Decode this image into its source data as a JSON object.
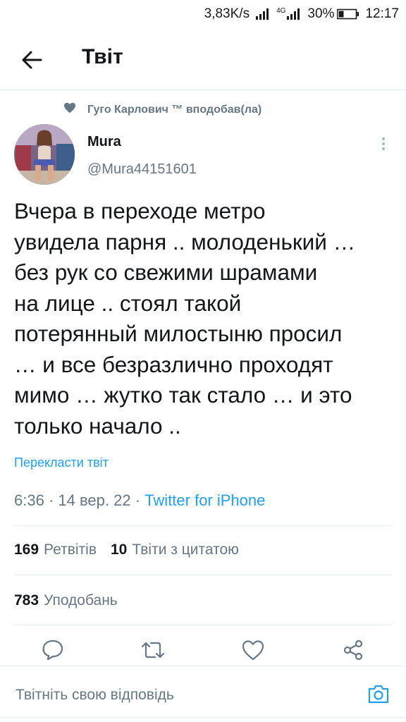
{
  "status_bar": {
    "speed": "3,83K/s",
    "network": "4G",
    "battery": "30%",
    "time": "12:17"
  },
  "header": {
    "back_icon": "arrow-left-icon",
    "title": "Твіт"
  },
  "social_context": {
    "icon": "heart-icon",
    "text": "Гуго Карлович ™ вподобав(ла)"
  },
  "author": {
    "name": "Mura",
    "handle": "@Mura44151601"
  },
  "tweet": {
    "text": "Вчера в переходе метро\nувидела парня .. молоденький …\nбез рук со свежими шрамами\nна лице .. стоял такой\nпотерянный милостыню просил\n… и все безразлично проходят\nмимо … жутко так стало … и это\nтолько начало ..",
    "translate_label": "Перекласти твіт",
    "time": "6:36",
    "date": "14 вер. 22",
    "separator": "·",
    "source": "Twitter for iPhone"
  },
  "stats": {
    "retweets_count": "169",
    "retweets_label": "Ретвітів",
    "quotes_count": "10",
    "quotes_label": "Твіти з цитатою",
    "likes_count": "783",
    "likes_label": "Уподобань"
  },
  "actions": [
    "reply-icon",
    "retweet-icon",
    "like-icon",
    "share-icon"
  ],
  "reply": {
    "placeholder": "Твітніть свою відповідь",
    "camera_icon": "camera-icon"
  },
  "colors": {
    "accent": "#1da1f2",
    "secondary_text": "#657786",
    "primary_text": "#14171a",
    "divider": "#e6ecf0"
  }
}
